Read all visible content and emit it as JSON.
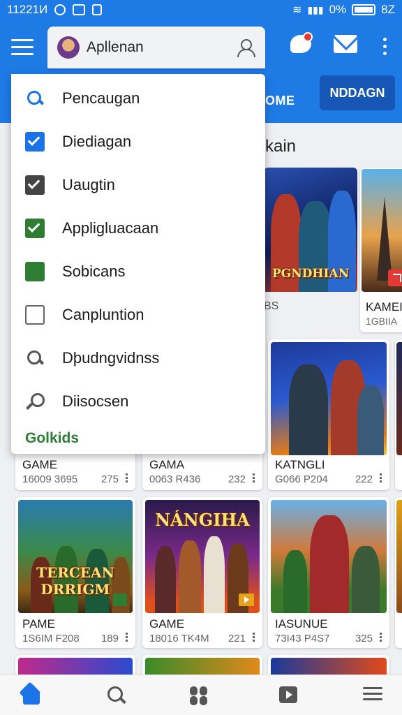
{
  "status_bar": {
    "time": "11221И",
    "battery": "0%",
    "signal_text": "8Z"
  },
  "app_bar": {
    "search_label": "Apllenan",
    "tab_home": "OME",
    "tab_button": "NDDAGN",
    "icons": [
      "menu-icon",
      "avatar",
      "user-icon",
      "notification-icon",
      "mail-icon",
      "more-vert-icon"
    ]
  },
  "section_title": "kain",
  "menu": {
    "items": [
      {
        "label": "Pencaugan",
        "icon": "search-icon"
      },
      {
        "label": "Diediagan",
        "icon": "checkbox-checked-blue-icon"
      },
      {
        "label": "Uaugtin",
        "icon": "checkbox-checked-dark-icon"
      },
      {
        "label": "Appligluacaan",
        "icon": "checkbox-checked-green-icon"
      },
      {
        "label": "Sobicans",
        "icon": "checkbox-filled-green-icon"
      },
      {
        "label": "Canpluntion",
        "icon": "checkbox-empty-icon"
      },
      {
        "label": "Dþudngvidnss",
        "icon": "search-grey-icon"
      },
      {
        "label": "Diisocsen",
        "icon": "key-icon"
      }
    ],
    "footer": "Golkids"
  },
  "cards": {
    "top_1": {
      "thumb_title": "PGNDHIAN",
      "name": "",
      "sub": "BS",
      "count": ""
    },
    "top_2": {
      "thumb_title": "",
      "name": "KAMEI",
      "sub": "1GBIIA",
      "count": ""
    },
    "row1": [
      {
        "name": "GAME",
        "sub": "16009 3695",
        "count": "275"
      },
      {
        "name": "GAMA",
        "sub": "0063 R436",
        "count": "232"
      },
      {
        "name": "KATNGLI",
        "sub": "G066 P204",
        "count": "222"
      }
    ],
    "row2": [
      {
        "thumb_title": "TERCEAN DRRIGM",
        "name": "PAME",
        "sub": "1S6IM F208",
        "count": "189"
      },
      {
        "thumb_title": "NÁNGIHA",
        "name": "GAME",
        "sub": "18016 TK4M",
        "count": "221"
      },
      {
        "thumb_title": "",
        "name": "IASUNUE",
        "sub": "73I43 P4S7",
        "count": "325"
      }
    ]
  },
  "bottom_nav": {
    "items": [
      "home-icon",
      "search-icon",
      "games-icon",
      "play-icon",
      "menu-icon"
    ],
    "active": "home-icon"
  },
  "colors": {
    "primary": "#1e7be6",
    "primary_dark": "#1656b5",
    "accent_green": "#2e7d32",
    "background": "#eef0f3"
  }
}
